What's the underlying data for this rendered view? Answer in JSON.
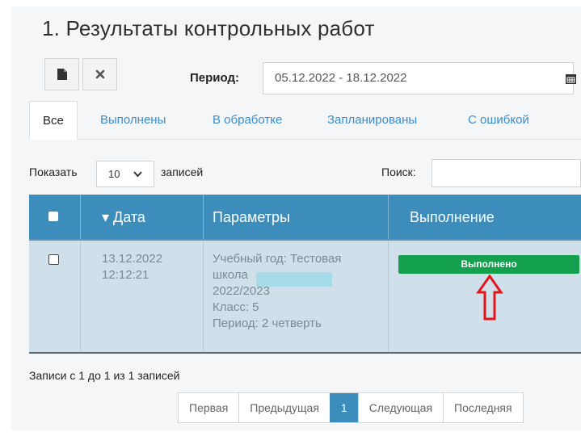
{
  "title": "1. Результаты контрольных работ",
  "toolbar": {
    "new_icon": "file-icon",
    "clear_icon": "close-icon",
    "period_label": "Период:",
    "period_value": "05.12.2022 - 18.12.2022",
    "calendar_icon": "calendar-icon"
  },
  "tabs": [
    {
      "label": "Все",
      "active": true
    },
    {
      "label": "Выполнены"
    },
    {
      "label": "В обработке"
    },
    {
      "label": "Запланированы"
    },
    {
      "label": "С ошибкой"
    }
  ],
  "table_controls": {
    "show_label": "Показать",
    "page_size": "10",
    "records_label": "записей",
    "search_label": "Поиск:",
    "search_value": ""
  },
  "table": {
    "columns": [
      "▾ Дата",
      "Параметры",
      "Выполнение"
    ],
    "rows": [
      {
        "date": "13.12.2022",
        "time": "12:12:21",
        "params": [
          "Учебный год: Тестовая",
          "школа",
          "2022/2023",
          "Класс: 5",
          "Период: 2 четверть"
        ],
        "status": "Выполнено"
      }
    ]
  },
  "info": "Записи с 1 до 1 из 1 записей",
  "pagination": {
    "first": "Первая",
    "prev": "Предыдущая",
    "current": "1",
    "next": "Следующая",
    "last": "Последняя"
  },
  "colors": {
    "header": "#3c8dbc",
    "status_success": "#13a14f",
    "annotation_arrow": "#e4141b"
  }
}
